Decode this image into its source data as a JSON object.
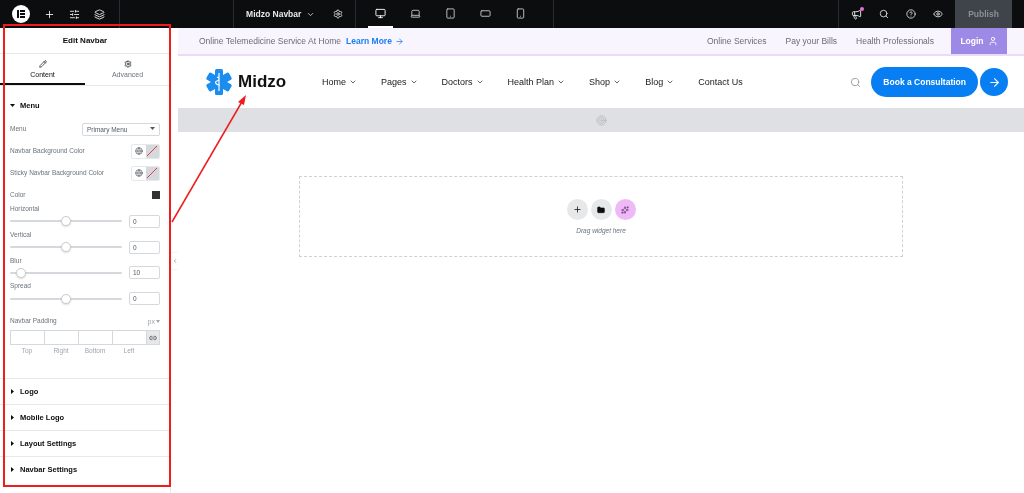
{
  "topbar": {
    "document_title": "Midzo Navbar",
    "devices": [
      {
        "kind": "desktop",
        "selected": true
      },
      {
        "kind": "laptop",
        "selected": false
      },
      {
        "kind": "tablet",
        "selected": false
      },
      {
        "kind": "tablet-landscape",
        "selected": false
      },
      {
        "kind": "mobile",
        "selected": false
      }
    ],
    "publish": "Publish"
  },
  "panel": {
    "title": "Edit Navbar",
    "tabs": [
      {
        "kind": "content",
        "label": "Content",
        "selected": true
      },
      {
        "kind": "advanced",
        "label": "Advanced",
        "selected": false
      }
    ],
    "open_section": {
      "title": "Menu",
      "expanded": true,
      "controls": [
        {
          "kind": "select",
          "label": "Menu",
          "value": "Primary Menu"
        },
        {
          "kind": "color",
          "label": "Navbar Background Color"
        },
        {
          "kind": "color",
          "label": "Sticky Navbar Background Color"
        },
        {
          "kind": "swatch",
          "label": "Color"
        },
        {
          "kind": "slider",
          "label": "Horizontal",
          "level": 0.5,
          "value": "0"
        },
        {
          "kind": "slider",
          "label": "Vertical",
          "level": 0.5,
          "value": "0"
        },
        {
          "kind": "slider",
          "label": "Blur",
          "level": 0.1,
          "value": "10"
        },
        {
          "kind": "slider",
          "label": "Spread",
          "level": 0.5,
          "value": "0"
        },
        {
          "kind": "dimensions",
          "label": "Navbar Padding",
          "unit": "px",
          "sides": [
            "Top",
            "Right",
            "Bottom",
            "Left"
          ]
        }
      ]
    },
    "sections": [
      {
        "title": "Logo",
        "expanded": false
      },
      {
        "title": "Mobile Logo",
        "expanded": false
      },
      {
        "title": "Layout Settings",
        "expanded": false
      },
      {
        "title": "Navbar Settings",
        "expanded": false
      }
    ]
  },
  "site": {
    "announcement": {
      "text": "Online Telemedicine Service At Home",
      "link": "Learn More"
    },
    "top_links": [
      "Online Services",
      "Pay your Bills",
      "Health Professionals"
    ],
    "login": "Login",
    "logo": "Midzo",
    "nav": [
      {
        "label": "Home",
        "dropdown": true
      },
      {
        "label": "Pages",
        "dropdown": true
      },
      {
        "label": "Doctors",
        "dropdown": true
      },
      {
        "label": "Health Plan",
        "dropdown": true
      },
      {
        "label": "Shop",
        "dropdown": true
      },
      {
        "label": "Blog",
        "dropdown": true
      },
      {
        "label": "Contact Us",
        "dropdown": false
      }
    ],
    "cta": "Book a Consultation",
    "drop_zone": "Drag widget here"
  }
}
